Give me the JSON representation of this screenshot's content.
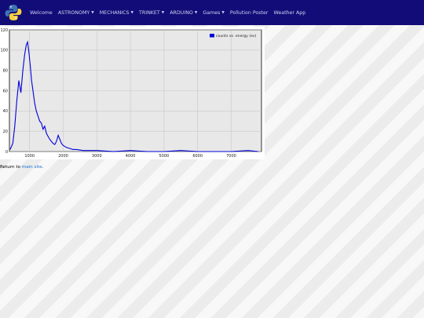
{
  "nav": {
    "items": [
      {
        "label": "Welcome",
        "dropdown": false
      },
      {
        "label": "ASTRONOMY",
        "dropdown": true
      },
      {
        "label": "MECHANICS",
        "dropdown": true
      },
      {
        "label": "TRINKET",
        "dropdown": true
      },
      {
        "label": "ARDUINO",
        "dropdown": true
      },
      {
        "label": "Games",
        "dropdown": true
      },
      {
        "label": "Pollution Poster",
        "dropdown": false
      },
      {
        "label": "Weather App",
        "dropdown": false
      }
    ],
    "caret_glyph": "▼",
    "logo_icon": "python-logo-icon"
  },
  "chart_data": {
    "type": "line",
    "legend": {
      "label": "counts vs. energy (ev)",
      "placement": "top-right"
    },
    "grid": true,
    "xlim": [
      400,
      7900
    ],
    "ylim": [
      0,
      120
    ],
    "x_ticks": [
      1000,
      2000,
      3000,
      4000,
      5000,
      6000,
      7000
    ],
    "y_ticks": [
      0,
      20,
      40,
      60,
      80,
      100,
      120
    ],
    "series": [
      {
        "name": "counts vs. energy (ev)",
        "color": "#0000dd",
        "x": [
          420,
          500,
          560,
          620,
          680,
          740,
          800,
          850,
          900,
          940,
          980,
          1020,
          1060,
          1100,
          1150,
          1200,
          1250,
          1300,
          1350,
          1400,
          1450,
          1500,
          1550,
          1600,
          1650,
          1700,
          1750,
          1800,
          1850,
          1900,
          1950,
          2000,
          2100,
          2200,
          2300,
          2400,
          2600,
          2800,
          3000,
          3500,
          4000,
          4500,
          5000,
          5500,
          6000,
          6500,
          7000,
          7500,
          7800
        ],
        "y": [
          2,
          8,
          25,
          50,
          70,
          58,
          80,
          95,
          105,
          108,
          98,
          85,
          70,
          60,
          48,
          40,
          35,
          30,
          28,
          22,
          25,
          18,
          15,
          12,
          10,
          8,
          7,
          10,
          16,
          12,
          8,
          6,
          4,
          3,
          2,
          2,
          1,
          1,
          1,
          0,
          1,
          0,
          0,
          1,
          0,
          0,
          0,
          1,
          0
        ]
      }
    ]
  },
  "footer": {
    "prefix": "Return to",
    "link_text": "main site",
    "suffix": "."
  }
}
